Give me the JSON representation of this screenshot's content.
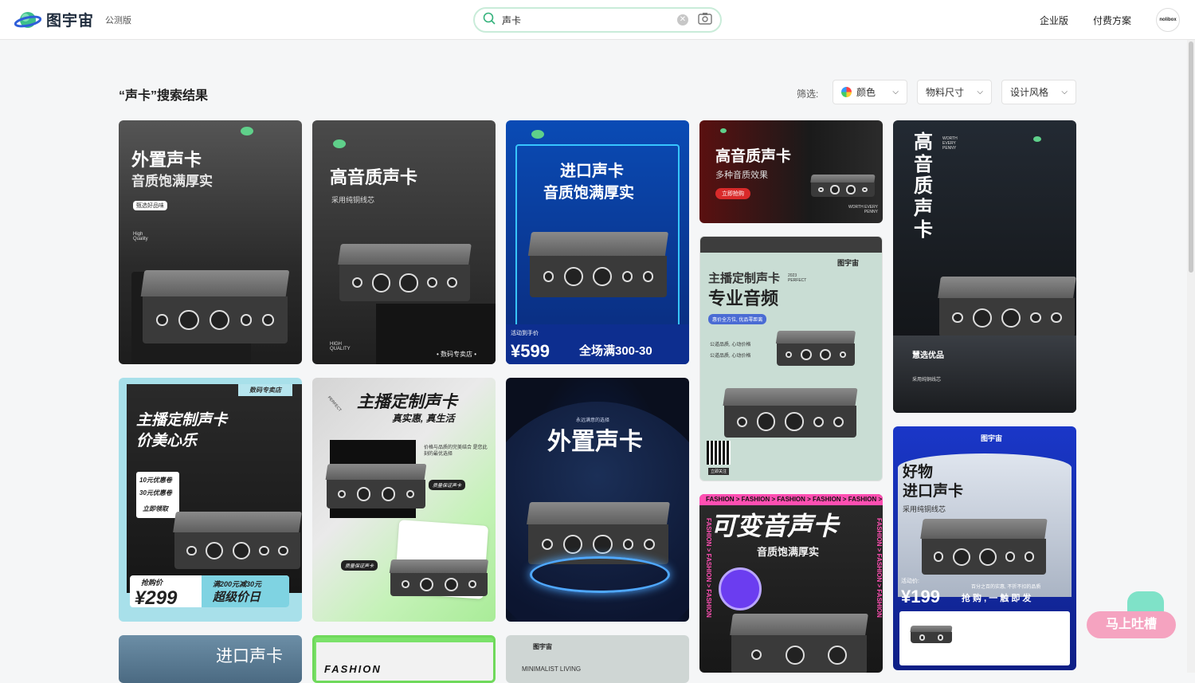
{
  "header": {
    "logo_text": "图宇宙",
    "beta": "公测版",
    "search_value": "声卡",
    "nav": [
      "企业版",
      "付费方案"
    ],
    "avatar": "nolibox"
  },
  "results": {
    "title": "“声卡”搜索结果",
    "filter_label": "筛选:",
    "filters": [
      "颜色",
      "物料尺寸",
      "设计风格"
    ]
  },
  "cards": [
    {
      "t1": "外置声卡",
      "t2": "音质饱满厚实",
      "tag": "甄选好品味",
      "note": "High Quality"
    },
    {
      "t1": "高音质声卡",
      "t2": "采用纯铜线芯",
      "foot": "• 数码专卖店 •",
      "note": "HIGH QUALITY"
    },
    {
      "t1": "进口声卡",
      "t2": "音质饱满厚实",
      "price_label": "活动到手价",
      "price": "¥599",
      "promo": "全场满300-30"
    },
    {
      "t1": "高音质声卡",
      "t2": "多种音质效果",
      "btn": "立即抢购",
      "note": "WORTH EVERY PENNY"
    },
    {
      "t1": "主播定制声卡",
      "t2": "专业音频",
      "brand": "图宇宙",
      "tag": "惠价全方位, 优品零距离",
      "c1": "公道品质, 心动价格",
      "c2": "公道品质, 心动价格",
      "qr": "立即关注",
      "year": "2023 PERFECT"
    },
    {
      "t1": "高音质声卡",
      "t2": "慧选优品",
      "t3": "采用纯铜线芯",
      "note": "WORTH EVERY PENNY"
    },
    {
      "t1": "主播定制声卡",
      "t2": "价美心乐",
      "shop": "数码专卖店",
      "v1": "10元优惠卷",
      "v2": "30元优惠卷",
      "v3": "立即领取",
      "label": "抢购价",
      "price": "¥299",
      "p1": "满200元减30元",
      "p2": "超级价日"
    },
    {
      "t1": "主播定制声卡",
      "t2": "真实惠, 真生活",
      "desc": "价格与品质的完美结合 是您此刻的最优选择",
      "b1": "质量保证声卡",
      "b2": "质量保证声卡",
      "tag": "PERFECT"
    },
    {
      "t1": "外置声卡",
      "t2": "永远满意的选择"
    },
    {
      "t1": "可变音声卡",
      "t2": "音质饱满厚实",
      "band": "FASHION > FASHION > FASHION > FASHION > FASHION >",
      "side": "FASHION > FASHION > FASHION"
    },
    {
      "t1": "好物",
      "t2": "进口声卡",
      "t3": "采用纯铜线芯",
      "brand": "图宇宙",
      "label": "活动价:",
      "price": "¥199",
      "desc": "百分之百的实惠, 不折不扣的品质",
      "slogan": "抢 购 , 一 触 即 发"
    },
    {
      "t1": "进口声卡"
    },
    {
      "t1": "FASHION"
    },
    {
      "t1": "MINIMALIST LIVING",
      "brand": "图宇宙"
    }
  ],
  "feedback": "马上吐槽"
}
